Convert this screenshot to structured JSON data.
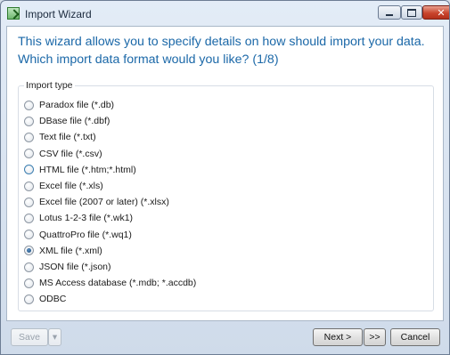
{
  "window": {
    "title": "Import Wizard",
    "close_glyph": "✕"
  },
  "heading": "This wizard allows you to specify details on how should import your data. Which import data format would you like? (1/8)",
  "import_type": {
    "legend": "Import type",
    "selected_index": 9,
    "options": [
      "Paradox file (*.db)",
      "DBase file (*.dbf)",
      "Text file (*.txt)",
      "CSV file (*.csv)",
      "HTML file (*.htm;*.html)",
      "Excel file (*.xls)",
      "Excel file (2007 or later) (*.xlsx)",
      "Lotus 1-2-3 file (*.wk1)",
      "QuattroPro file (*.wq1)",
      "XML file (*.xml)",
      "JSON file (*.json)",
      "MS Access database (*.mdb; *.accdb)",
      "ODBC"
    ]
  },
  "footer": {
    "save_label": "Save",
    "save_dropdown_glyph": "▾",
    "next_label": "Next >",
    "skip_label": ">>",
    "cancel_label": "Cancel"
  }
}
